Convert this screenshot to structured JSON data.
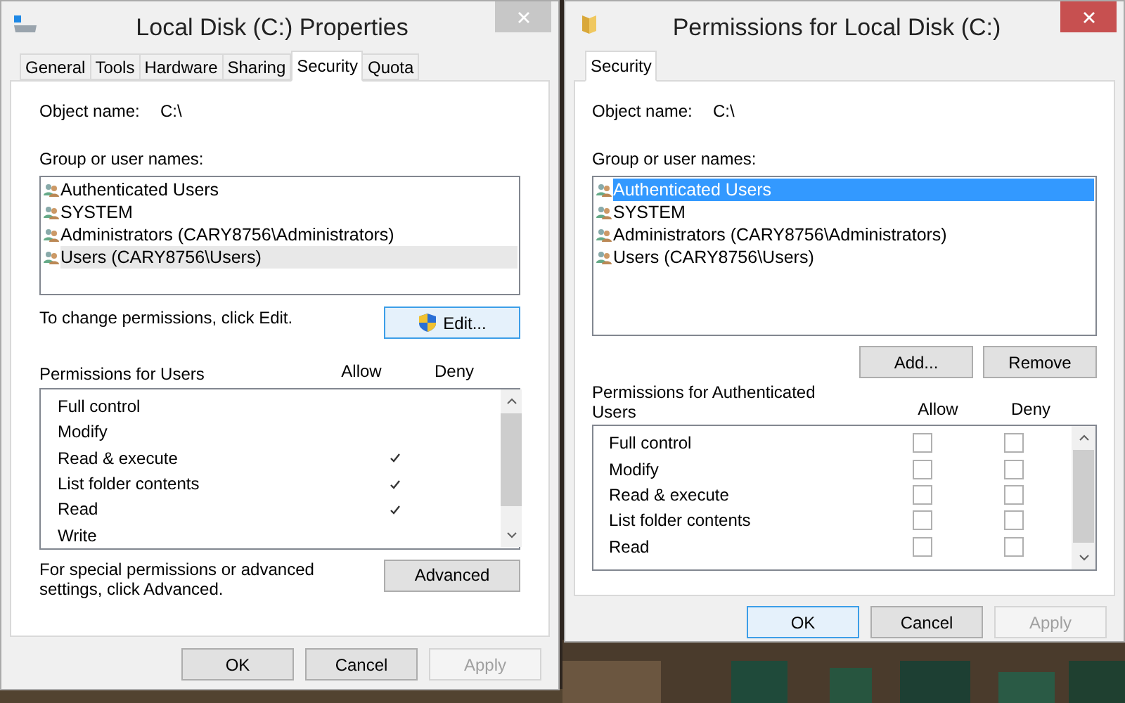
{
  "properties_window": {
    "title": "Local Disk (C:) Properties",
    "tabs": [
      {
        "label": "General",
        "selected": false
      },
      {
        "label": "Tools",
        "selected": false
      },
      {
        "label": "Hardware",
        "selected": false
      },
      {
        "label": "Sharing",
        "selected": false
      },
      {
        "label": "Security",
        "selected": true
      },
      {
        "label": "Quota",
        "selected": false
      }
    ],
    "object_label": "Object name:",
    "object_value": "C:\\",
    "groups_label": "Group or user names:",
    "groups": [
      {
        "name": "Authenticated Users",
        "selected": false
      },
      {
        "name": "SYSTEM",
        "selected": false
      },
      {
        "name": "Administrators (CARY8756\\Administrators)",
        "selected": false
      },
      {
        "name": "Users (CARY8756\\Users)",
        "selected": true
      }
    ],
    "edit_hint": "To change permissions, click Edit.",
    "edit_button": "Edit...",
    "permissions_label": "Permissions for Users",
    "allow_label": "Allow",
    "deny_label": "Deny",
    "permissions": [
      {
        "name": "Full control",
        "allow": false,
        "deny": false
      },
      {
        "name": "Modify",
        "allow": false,
        "deny": false
      },
      {
        "name": "Read & execute",
        "allow": true,
        "deny": false
      },
      {
        "name": "List folder contents",
        "allow": true,
        "deny": false
      },
      {
        "name": "Read",
        "allow": true,
        "deny": false
      },
      {
        "name": "Write",
        "allow": false,
        "deny": false
      }
    ],
    "advanced_hint": "For special permissions or advanced settings, click Advanced.",
    "advanced_button": "Advanced",
    "buttons": [
      {
        "label": "OK",
        "disabled": false
      },
      {
        "label": "Cancel",
        "disabled": false
      },
      {
        "label": "Apply",
        "disabled": true
      }
    ]
  },
  "permissions_window": {
    "title": "Permissions for Local Disk (C:)",
    "tabs": [
      {
        "label": "Security",
        "selected": true
      }
    ],
    "object_label": "Object name:",
    "object_value": "C:\\",
    "groups_label": "Group or user names:",
    "groups": [
      {
        "name": "Authenticated Users",
        "selected": true
      },
      {
        "name": "SYSTEM",
        "selected": false
      },
      {
        "name": "Administrators (CARY8756\\Administrators)",
        "selected": false
      },
      {
        "name": "Users (CARY8756\\Users)",
        "selected": false
      }
    ],
    "add_button": "Add...",
    "remove_button": "Remove",
    "permissions_label": "Permissions for Authenticated Users",
    "allow_label": "Allow",
    "deny_label": "Deny",
    "permissions": [
      {
        "name": "Full control",
        "allow": false,
        "deny": false
      },
      {
        "name": "Modify",
        "allow": false,
        "deny": false
      },
      {
        "name": "Read & execute",
        "allow": false,
        "deny": false
      },
      {
        "name": "List folder contents",
        "allow": false,
        "deny": false
      },
      {
        "name": "Read",
        "allow": false,
        "deny": false
      }
    ],
    "buttons": [
      {
        "label": "OK",
        "disabled": false
      },
      {
        "label": "Cancel",
        "disabled": false
      },
      {
        "label": "Apply",
        "disabled": true
      }
    ]
  }
}
